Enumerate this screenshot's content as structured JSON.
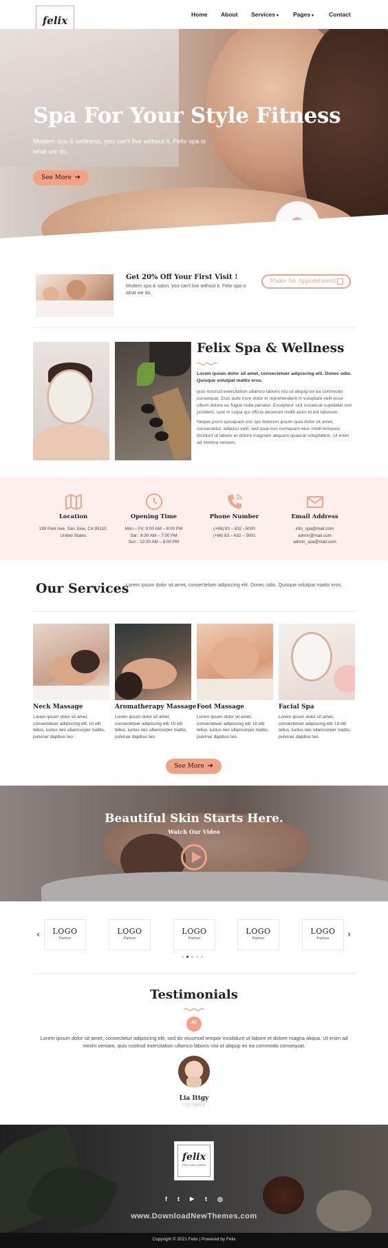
{
  "brand": {
    "logo_main": "felix",
    "logo_sub": "SPA & WELLNESS"
  },
  "nav": {
    "items": [
      {
        "label": "Home"
      },
      {
        "label": "About"
      },
      {
        "label": "Services"
      },
      {
        "label": "Pages"
      },
      {
        "label": "Contact"
      }
    ],
    "caret": "▾"
  },
  "hero": {
    "title": "Spa For Your Style Fitness",
    "subtitle": "Modern spa & wellness, you can't live without it. Felix spa is what we do.",
    "button": "See More"
  },
  "offer": {
    "title": "Get 20% Off Your First Visit !",
    "text": "Modern spa & salon, you can't live without it. Felix spa is what we do.",
    "button": "Make An Appointment"
  },
  "about": {
    "title": "Felix Spa & Wellness",
    "bold": "Lorem ipsum dolor sit amet, consectetuer adipiscing elit. Donec odio. Quisque volutpat mattis eros.",
    "p1": "quis nostrud exercitation ullamco laboris nisi ut aliquip ex ea commodo consequat. Duis aute irure dolor in reprehenderit in voluptate velit esse cillum dolore eu fugiat nulla pariatur. Excepteur sint occaecat cupidatat non proident, sunt in culpa qui officia deserunt mollit anim id est laborum.",
    "p2": "Neque porro quisquam est, qui dolorem ipsum quia dolor sit amet, consectetur, adipisci velit, sed quia non numquam eius modi tempora incidunt ut labore et dolore magnam aliquam quaerat voluptatem. Ut enim ad minima veniam,"
  },
  "info": [
    {
      "icon": "map-icon",
      "title": "Location",
      "lines": [
        "199 Park Ave, San Jose, CA 95110,",
        "United States"
      ]
    },
    {
      "icon": "clock-icon",
      "title": "Opening Time",
      "lines": [
        "Mon – Fri: 9:00 AM – 8:00 PM",
        "Sat : 8:30 AM – 7:00 PM",
        "Sun : 10:30 AM – 6:00 PM"
      ]
    },
    {
      "icon": "phone-icon",
      "title": "Phone Number",
      "lines": [
        "(+66) 83 – 632 –5000",
        "(+66) 83 – 632 – 5001"
      ]
    },
    {
      "icon": "mail-icon",
      "title": "Email Address",
      "lines": [
        "info_spa@mail.com",
        "admin@mail.com",
        "admin_spa@mail.com"
      ]
    }
  ],
  "services": {
    "heading": "Our Services",
    "intro": "Lorem ipsum dolor sit amet, consectetuer adipiscing elit. Donec odio. Quisque volutpat mattis eros.",
    "items": [
      {
        "title": "Neck Massage",
        "text": "Lorem ipsum dolor sit amet, consectetuer adipiscing elit. Ut elit tellus, luctus nec ullamcorper mattis, pulvinar dapibus leo."
      },
      {
        "title": "Aromatherapy Massage",
        "text": "Lorem ipsum dolor sit amet, consectetuer adipiscing elit. Ut elit tellus, luctus nec ullamcorper mattis, pulvinar dapibus leo."
      },
      {
        "title": "Foot Massage",
        "text": "Lorem ipsum dolor sit amet, consectetuer adipiscing elit. Ut elit tellus, luctus nec ullamcorper mattis, pulvinar dapibus leo."
      },
      {
        "title": "Facial Spa",
        "text": "Lorem ipsum dolor sit amet, consectetuer adipiscing elit. Ut elit tellus, luctus nec ullamcorper mattis, pulvinar dapibus leo."
      }
    ],
    "button": "See More"
  },
  "video": {
    "title": "Beautiful Skin Starts Here.",
    "subtitle": "Watch Our Video"
  },
  "partners": {
    "items": [
      {
        "logo": "LOGO",
        "label": "Partner"
      },
      {
        "logo": "LOGO",
        "label": "Partner"
      },
      {
        "logo": "LOGO",
        "label": "Partner"
      },
      {
        "logo": "LOGO",
        "label": "Partner"
      },
      {
        "logo": "LOGO",
        "label": "Partner"
      }
    ],
    "prev": "‹",
    "next": "›"
  },
  "testimonials": {
    "title": "Testimonials",
    "quote_mark": "“",
    "text": "Lorem ipsum dolor sit amet, consectetur adipiscing elit, sed do eiusmod tempor incididunt ut labore et dolore magna aliqua. Ut enim ad minim veniam, quis nostrud exercitation ullamco laboris nisi ut aliquip ex ea commodo consequat.",
    "name": "Lia Ittgy",
    "role": "CUSTOMER"
  },
  "footer": {
    "logo_main": "felix",
    "logo_sub": "SPA & WELLNESS",
    "social": [
      "f",
      "t",
      "▶",
      "t",
      "◎"
    ],
    "watermark": "www.DownloadNewThemes.com",
    "copyright": "Copyright © 2021 Felix | Powered by Felix"
  },
  "colors": {
    "accent": "#f4a285",
    "soft_bg": "#fdf0ec",
    "text": "#222222"
  }
}
